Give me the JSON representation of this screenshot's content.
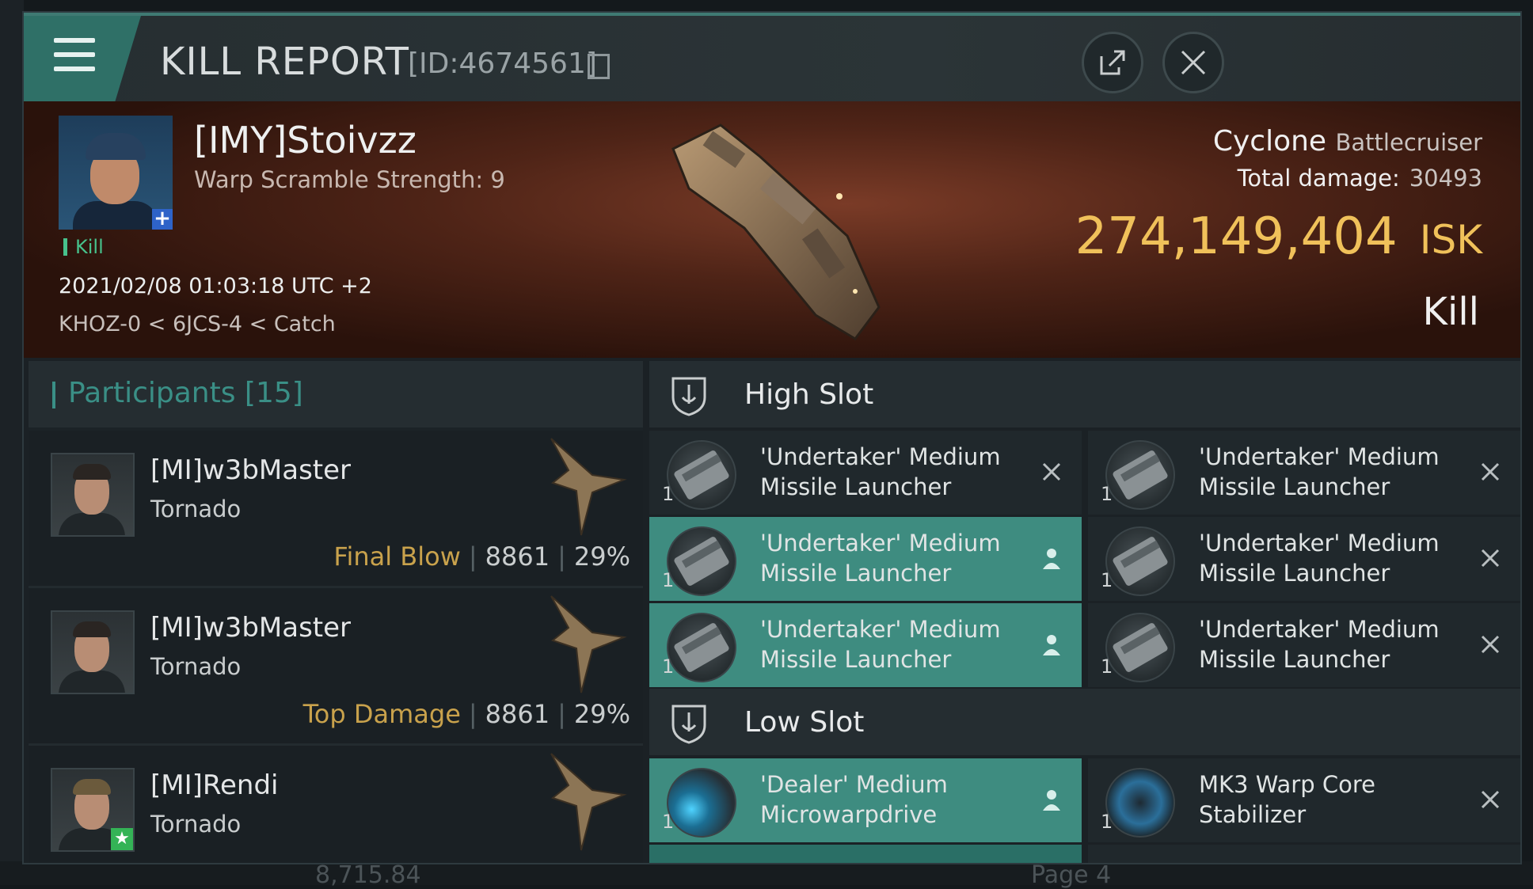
{
  "window": {
    "title": "KILL REPORT",
    "report_id": "[ID:4674561]"
  },
  "victim": {
    "name": "[IMY]Stoivzz",
    "warp_scramble": "Warp Scramble Strength: 9",
    "kill_tag": "Kill",
    "datetime": "2021/02/08 01:03:18 UTC +2",
    "location": "KHOZ-0 < 6JCS-4 < Catch",
    "ship_name": "Cyclone",
    "ship_class": "Battlecruiser",
    "damage_label": "Total damage:",
    "total_damage": "30493",
    "isk_value": "274,149,404",
    "isk_unit": "ISK",
    "result": "Kill"
  },
  "participants": {
    "header_label": "Participants",
    "count": "[15]",
    "list": [
      {
        "name": "[MI]w3bMaster",
        "ship": "Tornado",
        "tag": "Final Blow",
        "damage": "8861",
        "percent": "29%"
      },
      {
        "name": "[MI]w3bMaster",
        "ship": "Tornado",
        "tag": "Top Damage",
        "damage": "8861",
        "percent": "29%"
      },
      {
        "name": "[MI]Rendi",
        "ship": "Tornado"
      }
    ]
  },
  "slots": {
    "high": {
      "label": "High Slot",
      "items": [
        {
          "name_l1": "'Undertaker' Medium",
          "name_l2": "Missile Launcher",
          "qty": "1",
          "status": "destroyed"
        },
        {
          "name_l1": "'Undertaker' Medium",
          "name_l2": "Missile Launcher",
          "qty": "1",
          "status": "destroyed"
        },
        {
          "name_l1": "'Undertaker' Medium",
          "name_l2": "Missile Launcher",
          "qty": "1",
          "status": "dropped"
        },
        {
          "name_l1": "'Undertaker' Medium",
          "name_l2": "Missile Launcher",
          "qty": "1",
          "status": "destroyed"
        },
        {
          "name_l1": "'Undertaker' Medium",
          "name_l2": "Missile Launcher",
          "qty": "1",
          "status": "dropped"
        },
        {
          "name_l1": "'Undertaker' Medium",
          "name_l2": "Missile Launcher",
          "qty": "1",
          "status": "destroyed"
        }
      ]
    },
    "low": {
      "label": "Low Slot",
      "items": [
        {
          "name_l1": "'Dealer' Medium",
          "name_l2": "Microwarpdrive",
          "qty": "1",
          "status": "dropped"
        },
        {
          "name_l1": "MK3 Warp Core",
          "name_l2": "Stabilizer",
          "qty": "1",
          "status": "destroyed"
        }
      ]
    }
  },
  "background": {
    "page_label": "Page 4",
    "value": "8,715.84"
  },
  "colors": {
    "accent": "#3a8f86",
    "isk": "#f0c15a",
    "dropped": "#3e8c80",
    "kill": "#47c28c"
  }
}
